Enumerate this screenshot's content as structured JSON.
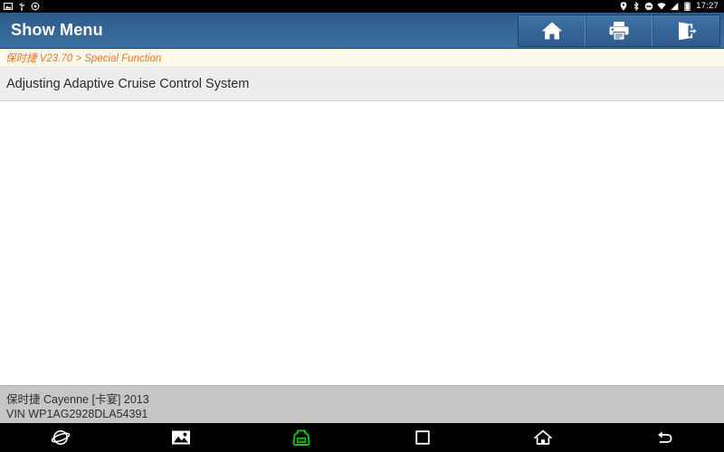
{
  "statusbar": {
    "left_icons": [
      {
        "name": "screenshot-icon"
      },
      {
        "name": "usb-icon"
      },
      {
        "name": "debug-settings-icon"
      }
    ],
    "right_icons": [
      {
        "name": "location-pin-icon"
      },
      {
        "name": "bluetooth-icon"
      },
      {
        "name": "do-not-disturb-icon"
      },
      {
        "name": "wifi-icon"
      },
      {
        "name": "cellular-signal-icon"
      },
      {
        "name": "battery-icon"
      }
    ],
    "time": "17:27"
  },
  "header": {
    "title": "Show Menu",
    "toolbar": [
      {
        "name": "home-button",
        "icon": "home-icon",
        "label": "Home"
      },
      {
        "name": "print-button",
        "icon": "printer-icon",
        "label": "Print"
      },
      {
        "name": "exit-button",
        "icon": "exit-door-icon",
        "label": "Exit"
      }
    ]
  },
  "breadcrumb": {
    "text": "保时捷 V23.70 > Special Function"
  },
  "menu": {
    "items": [
      {
        "label": "Adjusting Adaptive Cruise Control System"
      }
    ]
  },
  "vehicle": {
    "model": "保时捷 Cayenne [卡宴] 2013",
    "vin": "VIN WP1AG2928DLA54391"
  },
  "navbar": {
    "items": [
      {
        "name": "browser-icon",
        "label": "Browser"
      },
      {
        "name": "gallery-icon",
        "label": "Gallery"
      },
      {
        "name": "vci-connector-icon",
        "label": "VCI"
      },
      {
        "name": "recents-icon",
        "label": "Recents"
      },
      {
        "name": "home-nav-icon",
        "label": "Home"
      },
      {
        "name": "back-icon",
        "label": "Back"
      }
    ]
  },
  "colors": {
    "header_blue": "#336595",
    "breadcrumb_bg": "#fdfaec",
    "breadcrumb_text": "#f0712a",
    "menu_row_bg": "#ededed",
    "vehicle_bg": "#c6c6c6",
    "vci_green": "#18c218"
  }
}
